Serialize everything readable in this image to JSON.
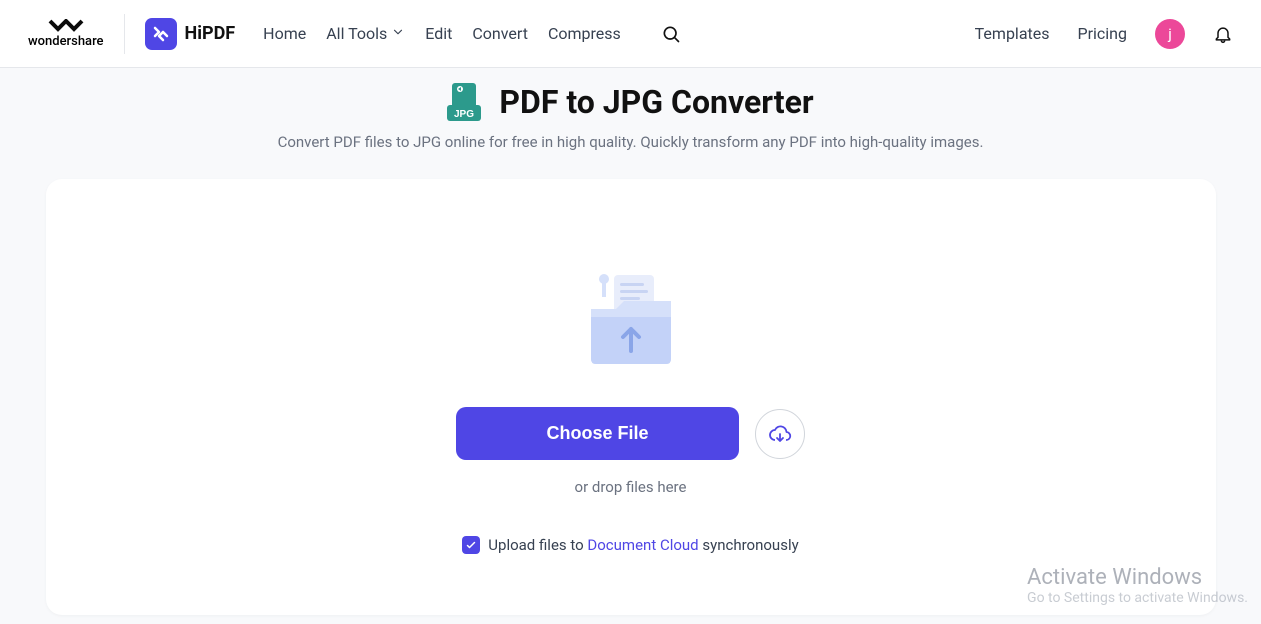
{
  "header": {
    "brand1": "wondershare",
    "brand2": "HiPDF",
    "nav": {
      "home": "Home",
      "allTools": "All Tools",
      "edit": "Edit",
      "convert": "Convert",
      "compress": "Compress"
    },
    "right": {
      "templates": "Templates",
      "pricing": "Pricing",
      "avatarInitial": "j"
    }
  },
  "page": {
    "title": "PDF to JPG Converter",
    "subtitle": "Convert PDF files to JPG online for free in high quality. Quickly transform any PDF into high-quality images.",
    "iconBadge": "JPG"
  },
  "upload": {
    "chooseFile": "Choose File",
    "dropText": "or drop files here",
    "syncPrefix": "Upload files to ",
    "syncLink": "Document Cloud",
    "syncSuffix": " synchronously",
    "syncChecked": true
  },
  "watermark": {
    "title": "Activate Windows",
    "subtitle": "Go to Settings to activate Windows."
  }
}
